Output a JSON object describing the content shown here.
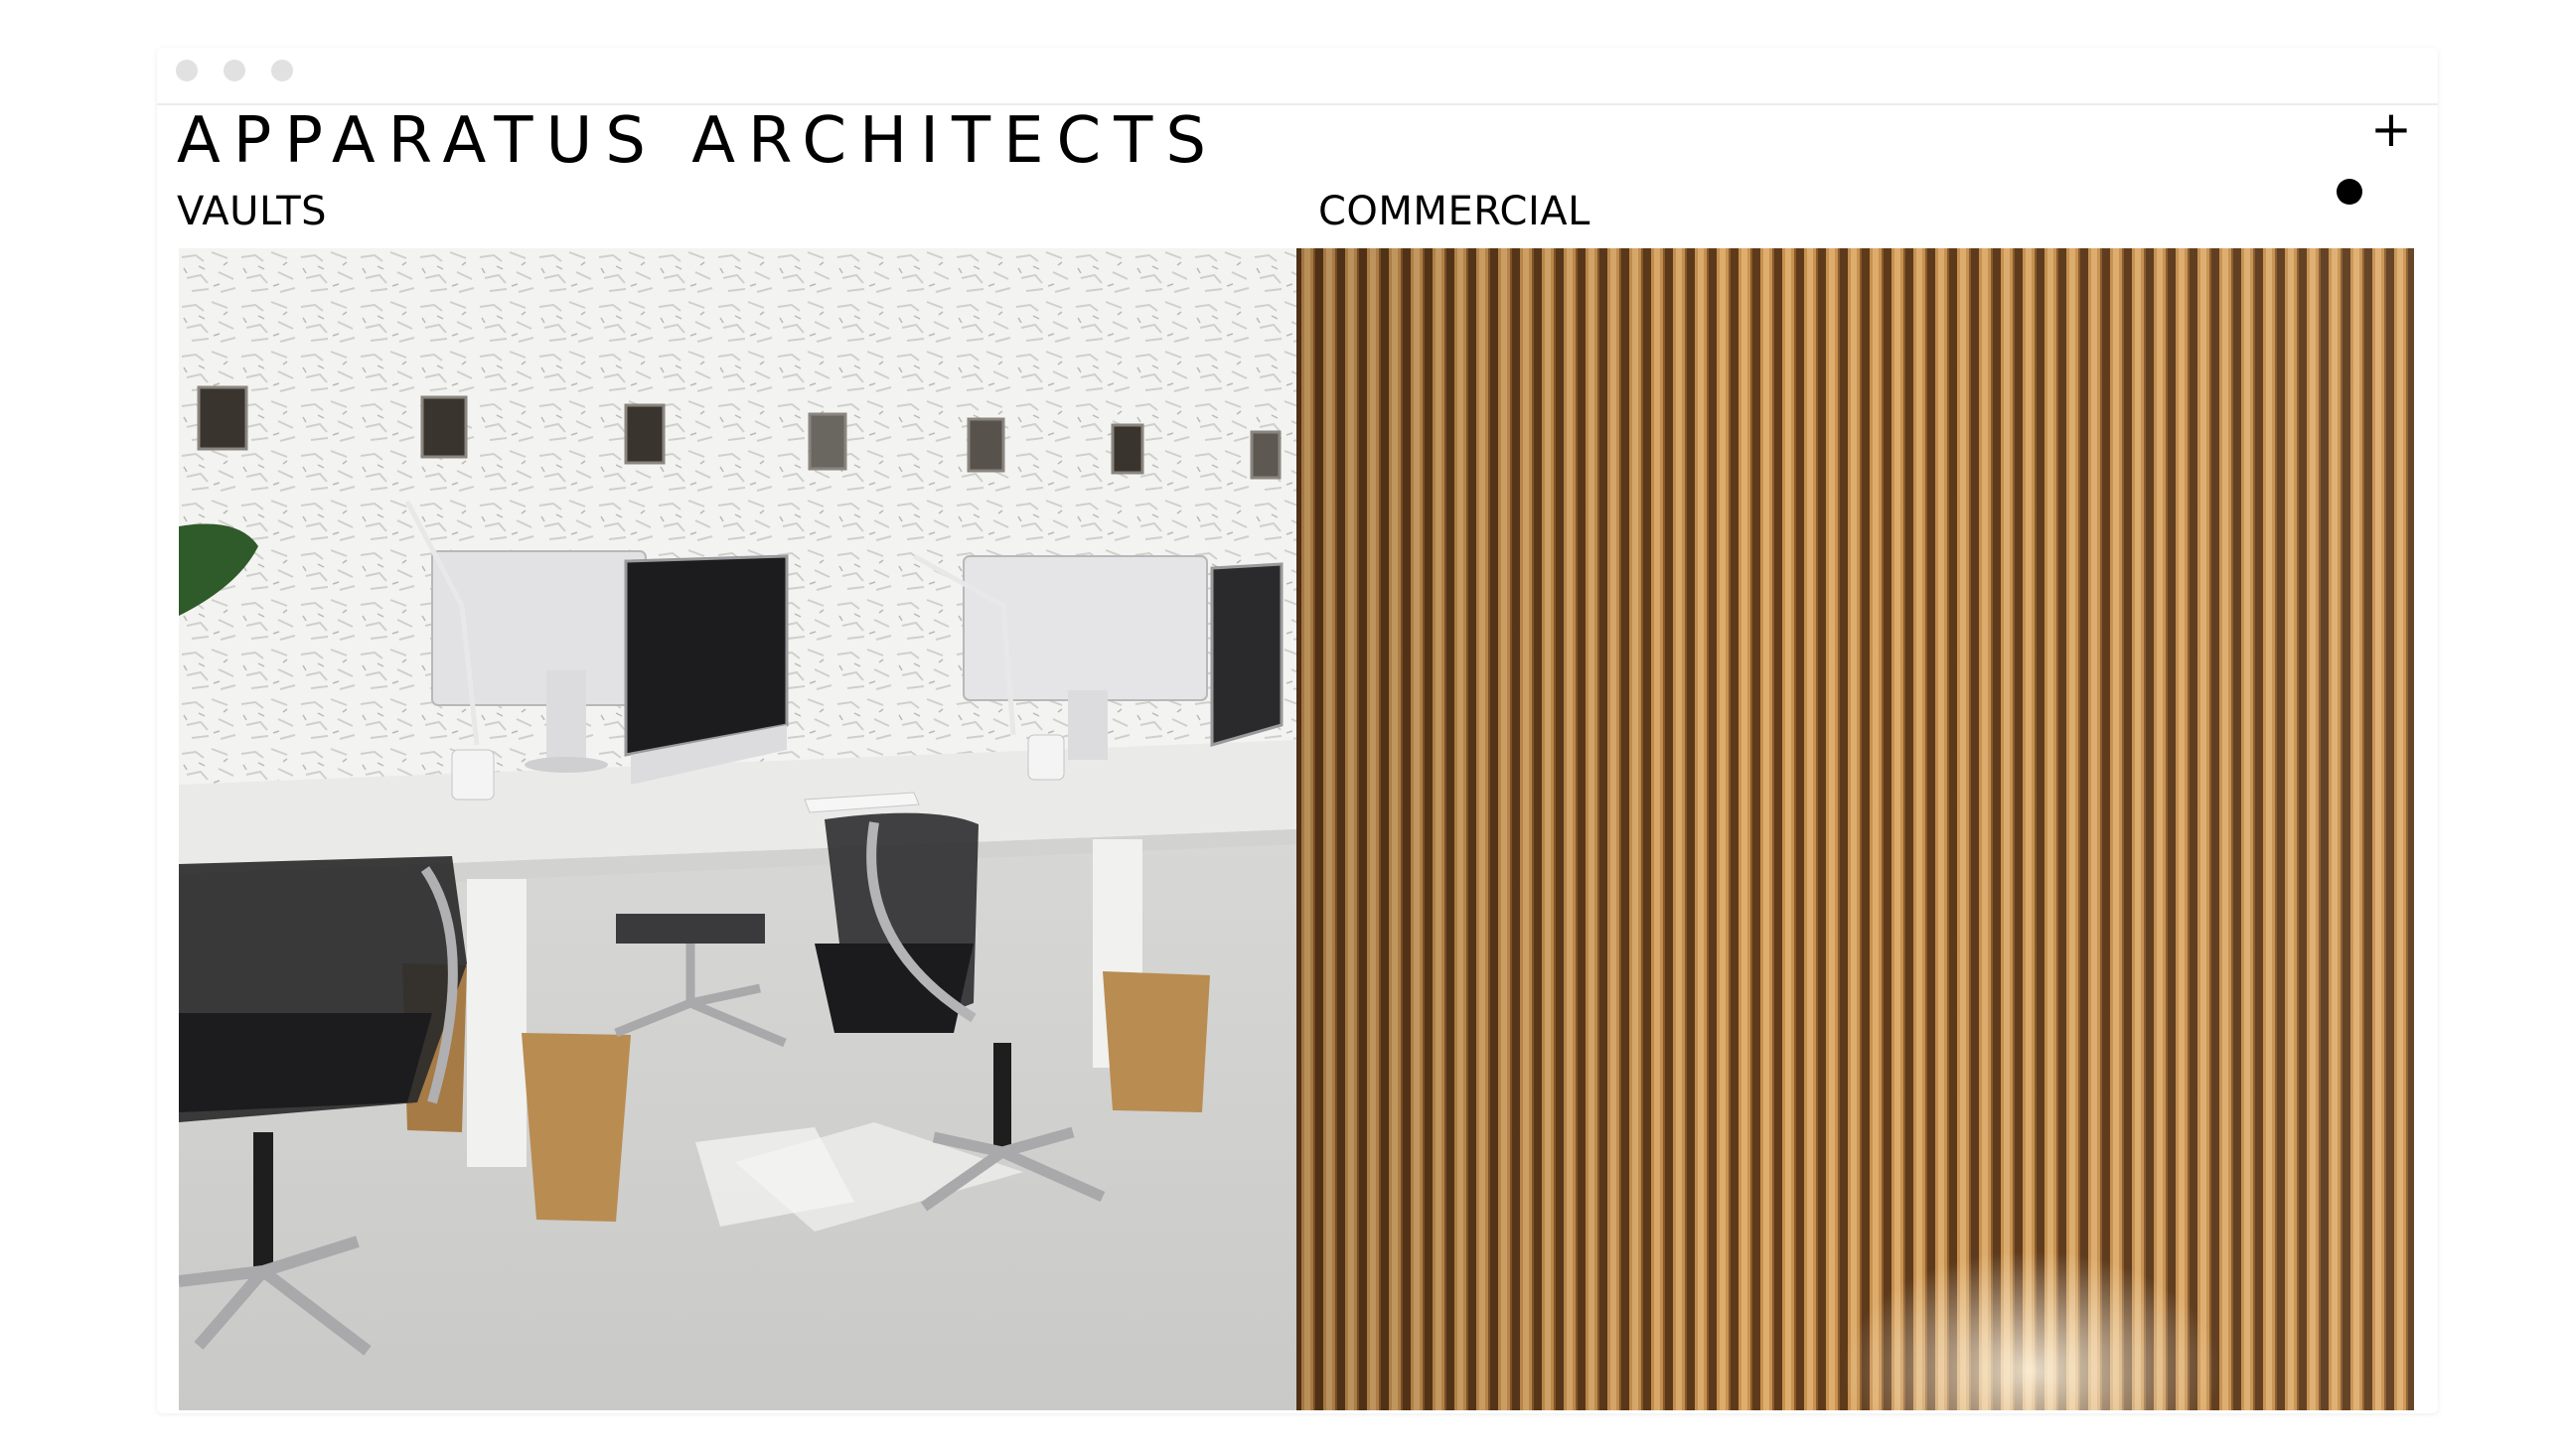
{
  "window": {
    "controls": [
      "close-dot",
      "minimize-dot",
      "maximize-dot"
    ]
  },
  "header": {
    "brand": "APPARATUS ARCHITECTS",
    "menu_icon": "plus-icon",
    "menu_symbol": "+"
  },
  "projects": [
    {
      "label": "VAULTS",
      "image": "office-desks-with-imacs-photo"
    },
    {
      "label": "COMMERCIAL",
      "image": "wooden-slat-wall-photo"
    }
  ],
  "colors": {
    "text": "#000000",
    "window_control": "#e1e1e1",
    "wood_light": "#d9a862",
    "wood_dark": "#6b4420",
    "wall_white": "#f2f2f0"
  }
}
